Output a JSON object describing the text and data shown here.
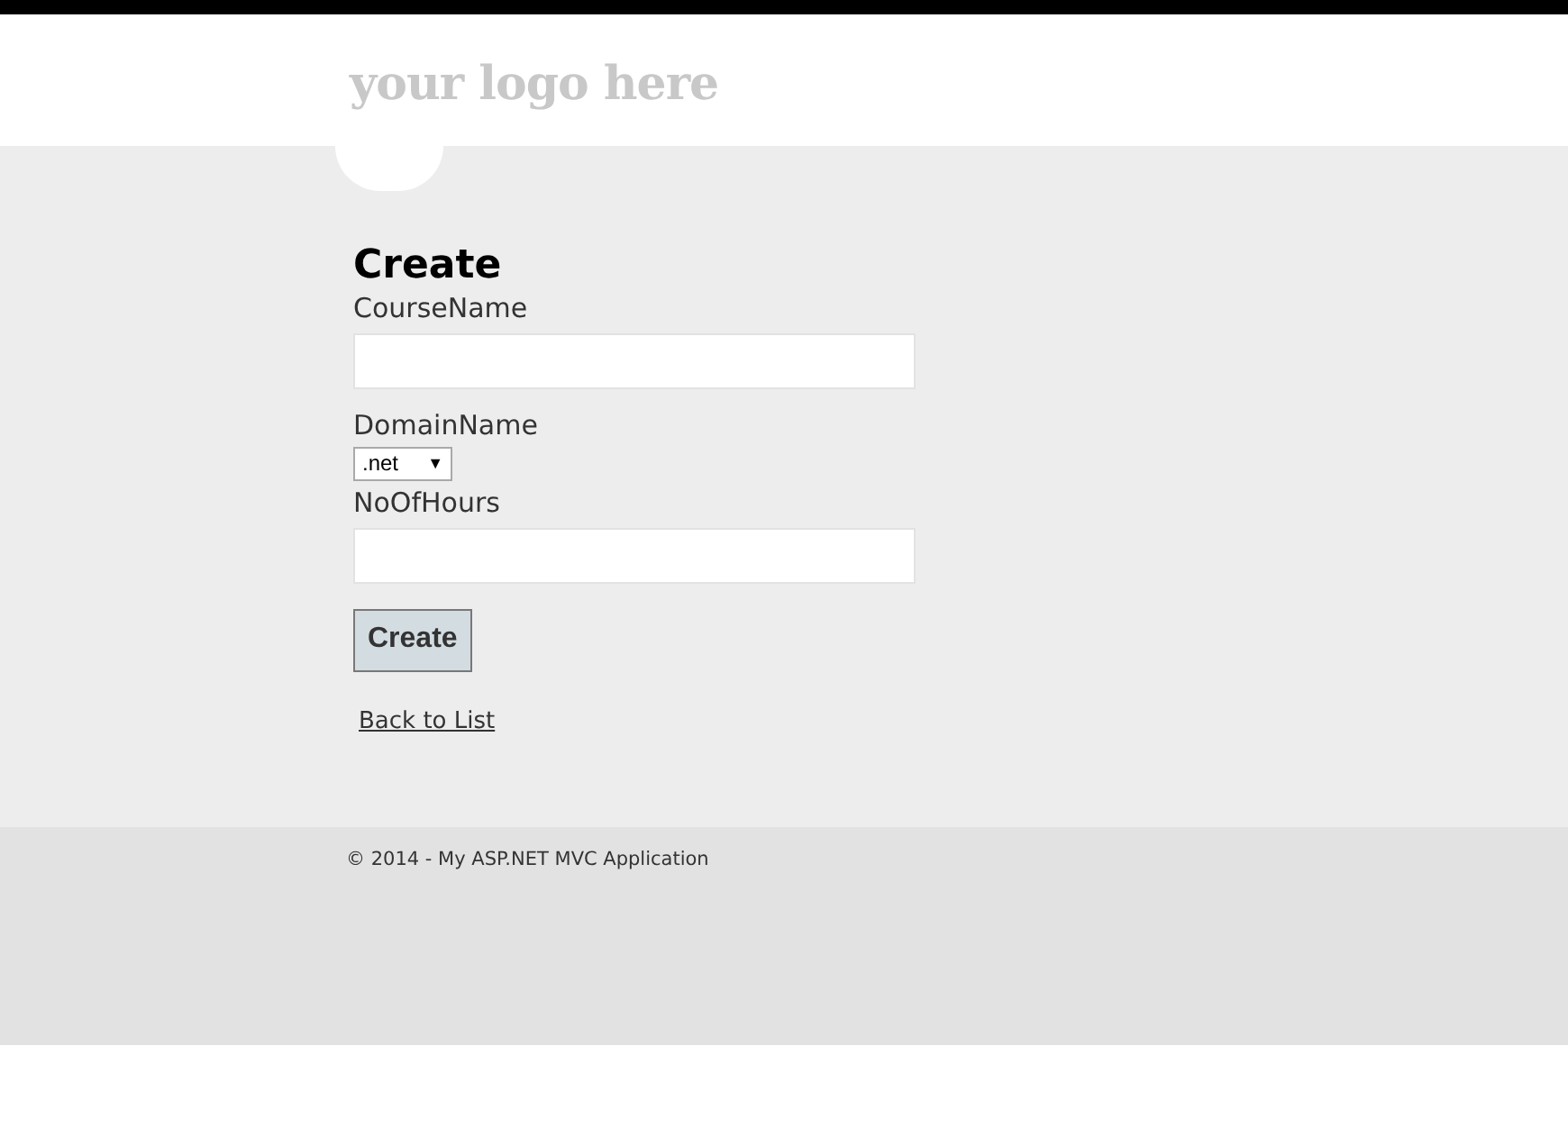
{
  "header": {
    "logo": "your logo here"
  },
  "form": {
    "title": "Create",
    "fields": [
      {
        "kind": "text",
        "label": "CourseName"
      },
      {
        "kind": "select",
        "label": "DomainName",
        "value": ".net",
        "arrow": "▼"
      },
      {
        "kind": "text",
        "label": "NoOfHours"
      }
    ],
    "submit": "Create"
  },
  "back_link": "Back to List",
  "footer": {
    "text": "© 2014 - My ASP.NET MVC Application"
  }
}
